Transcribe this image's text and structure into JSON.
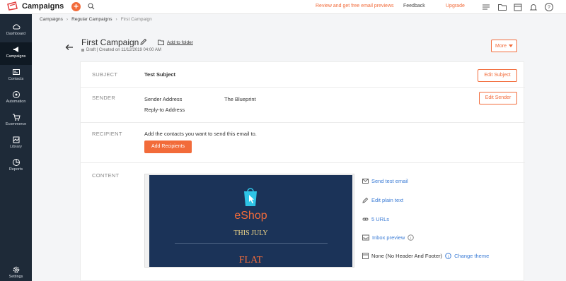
{
  "app": {
    "title": "Campaigns"
  },
  "topbar": {
    "promo_link": "Review and get free email previews",
    "feedback": "Feedback",
    "upgrade": "Upgrade",
    "accent_color": "#f26b3a"
  },
  "sidebar": {
    "items": [
      {
        "label": "Dashboard",
        "icon": "cloud-icon"
      },
      {
        "label": "Campaigns",
        "icon": "megaphone-icon"
      },
      {
        "label": "Contacts",
        "icon": "contact-card-icon"
      },
      {
        "label": "Automation",
        "icon": "automation-icon"
      },
      {
        "label": "Ecommerce",
        "icon": "cart-icon"
      },
      {
        "label": "Library",
        "icon": "library-icon"
      },
      {
        "label": "Reports",
        "icon": "pie-chart-icon"
      }
    ],
    "settings": "Settings"
  },
  "breadcrumb": [
    "Campaigns",
    "Regular Campaigns",
    "First Campaign"
  ],
  "campaign": {
    "title": "First Campaign",
    "add_folder": "Add to folder",
    "meta": "Draft | Created on 11/12/2019 04:00 AM",
    "more": "More"
  },
  "subject": {
    "label": "SUBJECT",
    "value": "Test Subject",
    "button": "Edit Subject"
  },
  "sender": {
    "label": "SENDER",
    "address_label": "Sender Address",
    "address_value": "The Blueprint",
    "reply_label": "Reply-to Address",
    "button": "Edit Sender"
  },
  "recipient": {
    "label": "RECIPIENT",
    "text": "Add the contacts you want to send this email to.",
    "button": "Add Recipients"
  },
  "content": {
    "label": "CONTENT",
    "preview": {
      "brand": "eShop",
      "headline": "THIS JULY",
      "offer": "FLAT"
    },
    "actions": {
      "send_test": "Send test email",
      "edit_plain": "Edit plain text",
      "urls": "5 URLs",
      "inbox_preview": "Inbox preview",
      "theme": "None (No Header And Footer)",
      "change_theme": "Change theme"
    }
  }
}
